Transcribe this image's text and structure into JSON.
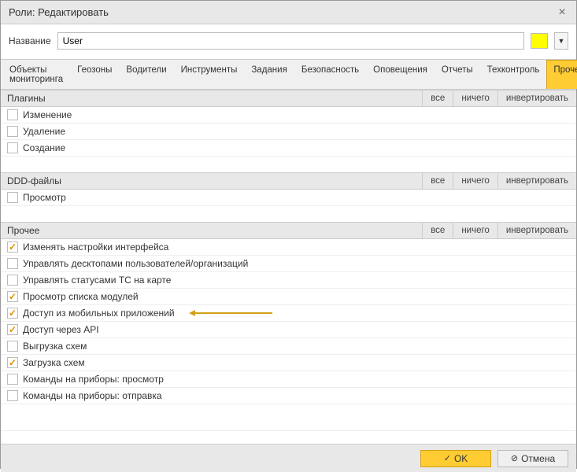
{
  "window": {
    "title": "Роли: Редактировать"
  },
  "name_row": {
    "label": "Название",
    "value": "User",
    "color": "#ffff00"
  },
  "tabs": [
    "Объекты мониторинга",
    "Геозоны",
    "Водители",
    "Инструменты",
    "Задания",
    "Безопасность",
    "Оповещения",
    "Отчеты",
    "Техконтроль",
    "Прочее"
  ],
  "active_tab": 9,
  "toggle_labels": {
    "all": "все",
    "none": "ничего",
    "invert": "инвертировать"
  },
  "sections": [
    {
      "title": "Плагины",
      "items": [
        {
          "label": "Изменение",
          "checked": false
        },
        {
          "label": "Удаление",
          "checked": false
        },
        {
          "label": "Создание",
          "checked": false
        }
      ]
    },
    {
      "title": "DDD-файлы",
      "items": [
        {
          "label": "Просмотр",
          "checked": false
        }
      ]
    },
    {
      "title": "Прочее",
      "items": [
        {
          "label": "Изменять настройки интерфейса",
          "checked": true
        },
        {
          "label": "Управлять десктопами пользователей/организаций",
          "checked": false
        },
        {
          "label": "Управлять статусами ТС на карте",
          "checked": false
        },
        {
          "label": "Просмотр списка модулей",
          "checked": true
        },
        {
          "label": "Доступ из мобильных приложений",
          "checked": true,
          "highlighted": true
        },
        {
          "label": "Доступ через API",
          "checked": true
        },
        {
          "label": "Выгрузка схем",
          "checked": false
        },
        {
          "label": "Загрузка схем",
          "checked": true
        },
        {
          "label": "Команды на приборы: просмотр",
          "checked": false
        },
        {
          "label": "Команды на приборы: отправка",
          "checked": false
        }
      ]
    }
  ],
  "footer": {
    "ok": "OK",
    "cancel": "Отмена"
  }
}
